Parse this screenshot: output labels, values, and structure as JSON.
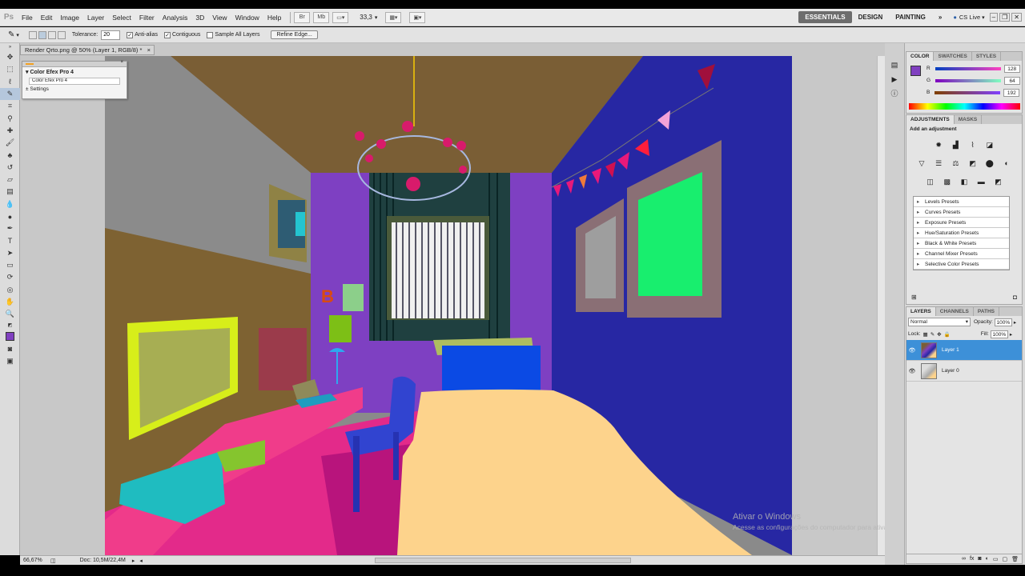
{
  "app": {
    "logo": "Ps"
  },
  "menu": [
    "File",
    "Edit",
    "Image",
    "Layer",
    "Select",
    "Filter",
    "Analysis",
    "3D",
    "View",
    "Window",
    "Help"
  ],
  "menubar": {
    "zoom_value": "33,3",
    "workspaces": [
      "ESSENTIALS",
      "DESIGN",
      "PAINTING"
    ],
    "more": "»",
    "cs_live": "CS Live"
  },
  "options": {
    "tolerance_label": "Tolerance:",
    "tolerance_value": "20",
    "anti_alias": "Anti-alias",
    "contiguous": "Contiguous",
    "sample_all": "Sample All Layers",
    "refine_edge": "Refine Edge..."
  },
  "document": {
    "tab_title": "Render Qrto.png @ 50% (Layer 1, RGB/8) *",
    "close": "×"
  },
  "efex": {
    "title": "Color Efex Pro 4",
    "item": "Color Efex Pro 4",
    "settings": "Settings"
  },
  "status": {
    "zoom": "66,67%",
    "doc": "Doc: 10,5M/22,4M"
  },
  "color_panel": {
    "tabs": [
      "COLOR",
      "SWATCHES",
      "STYLES"
    ],
    "R": {
      "label": "R",
      "value": 128
    },
    "G": {
      "label": "G",
      "value": 64
    },
    "B": {
      "label": "B",
      "value": 192
    },
    "foreground": "#8040c0"
  },
  "adjustments": {
    "tabs": [
      "ADJUSTMENTS",
      "MASKS"
    ],
    "heading": "Add an adjustment",
    "presets": [
      "Levels Presets",
      "Curves Presets",
      "Exposure Presets",
      "Hue/Saturation Presets",
      "Black & White Presets",
      "Channel Mixer Presets",
      "Selective Color Presets"
    ]
  },
  "layers": {
    "tabs": [
      "LAYERS",
      "CHANNELS",
      "PATHS"
    ],
    "blend_mode": "Normal",
    "opacity_label": "Opacity:",
    "opacity_value": "100%",
    "lock_label": "Lock:",
    "fill_label": "Fill:",
    "fill_value": "100%",
    "items": [
      {
        "name": "Layer 1",
        "active": true
      },
      {
        "name": "Layer 0",
        "active": false
      }
    ]
  },
  "watermark": {
    "title": "Ativar o Windows",
    "subtitle": "Acesse as configurações do computador para ativar o Windows."
  }
}
